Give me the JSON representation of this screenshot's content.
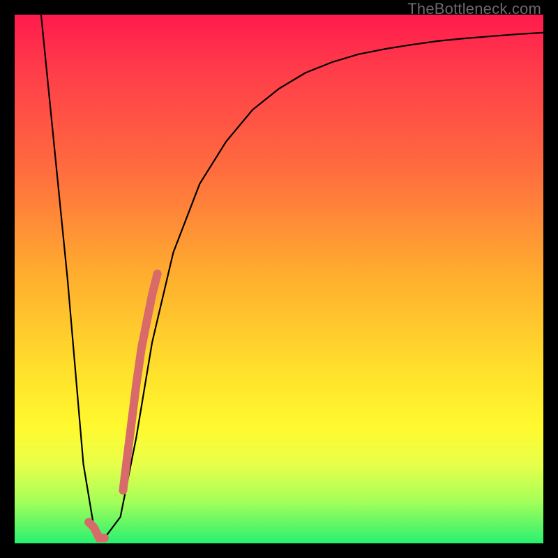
{
  "watermark": "TheBottleneck.com",
  "colors": {
    "frame": "#000000",
    "curve": "#000000",
    "highlight": "#d96a6a",
    "gradient_stops": [
      "#ff1a4d",
      "#ff3b4a",
      "#ff6e3e",
      "#ffb02e",
      "#ffe22c",
      "#fff92e",
      "#e8ff4a",
      "#a6ff59",
      "#28f070"
    ]
  },
  "chart_data": {
    "type": "line",
    "title": "",
    "xlabel": "",
    "ylabel": "",
    "xlim": [
      0,
      100
    ],
    "ylim": [
      0,
      100
    ],
    "series": [
      {
        "name": "bottleneck-curve",
        "x": [
          5,
          10,
          13,
          15,
          17,
          20,
          23,
          26,
          30,
          35,
          40,
          45,
          50,
          55,
          60,
          65,
          70,
          75,
          80,
          85,
          90,
          95,
          100
        ],
        "values": [
          100,
          50,
          15,
          3,
          1,
          5,
          20,
          38,
          55,
          68,
          76,
          82,
          86,
          89,
          91,
          92.5,
          93.5,
          94.3,
          95,
          95.5,
          95.9,
          96.3,
          96.6
        ]
      }
    ],
    "highlight_segments": [
      {
        "name": "minimum-marker",
        "x": [
          14,
          15,
          16,
          17
        ],
        "values": [
          4,
          3,
          1,
          1
        ]
      },
      {
        "name": "rising-steep-marker",
        "x": [
          20.5,
          22,
          23,
          24,
          25,
          26,
          27
        ],
        "values": [
          10,
          22,
          30,
          37,
          42,
          47,
          51
        ]
      }
    ]
  }
}
